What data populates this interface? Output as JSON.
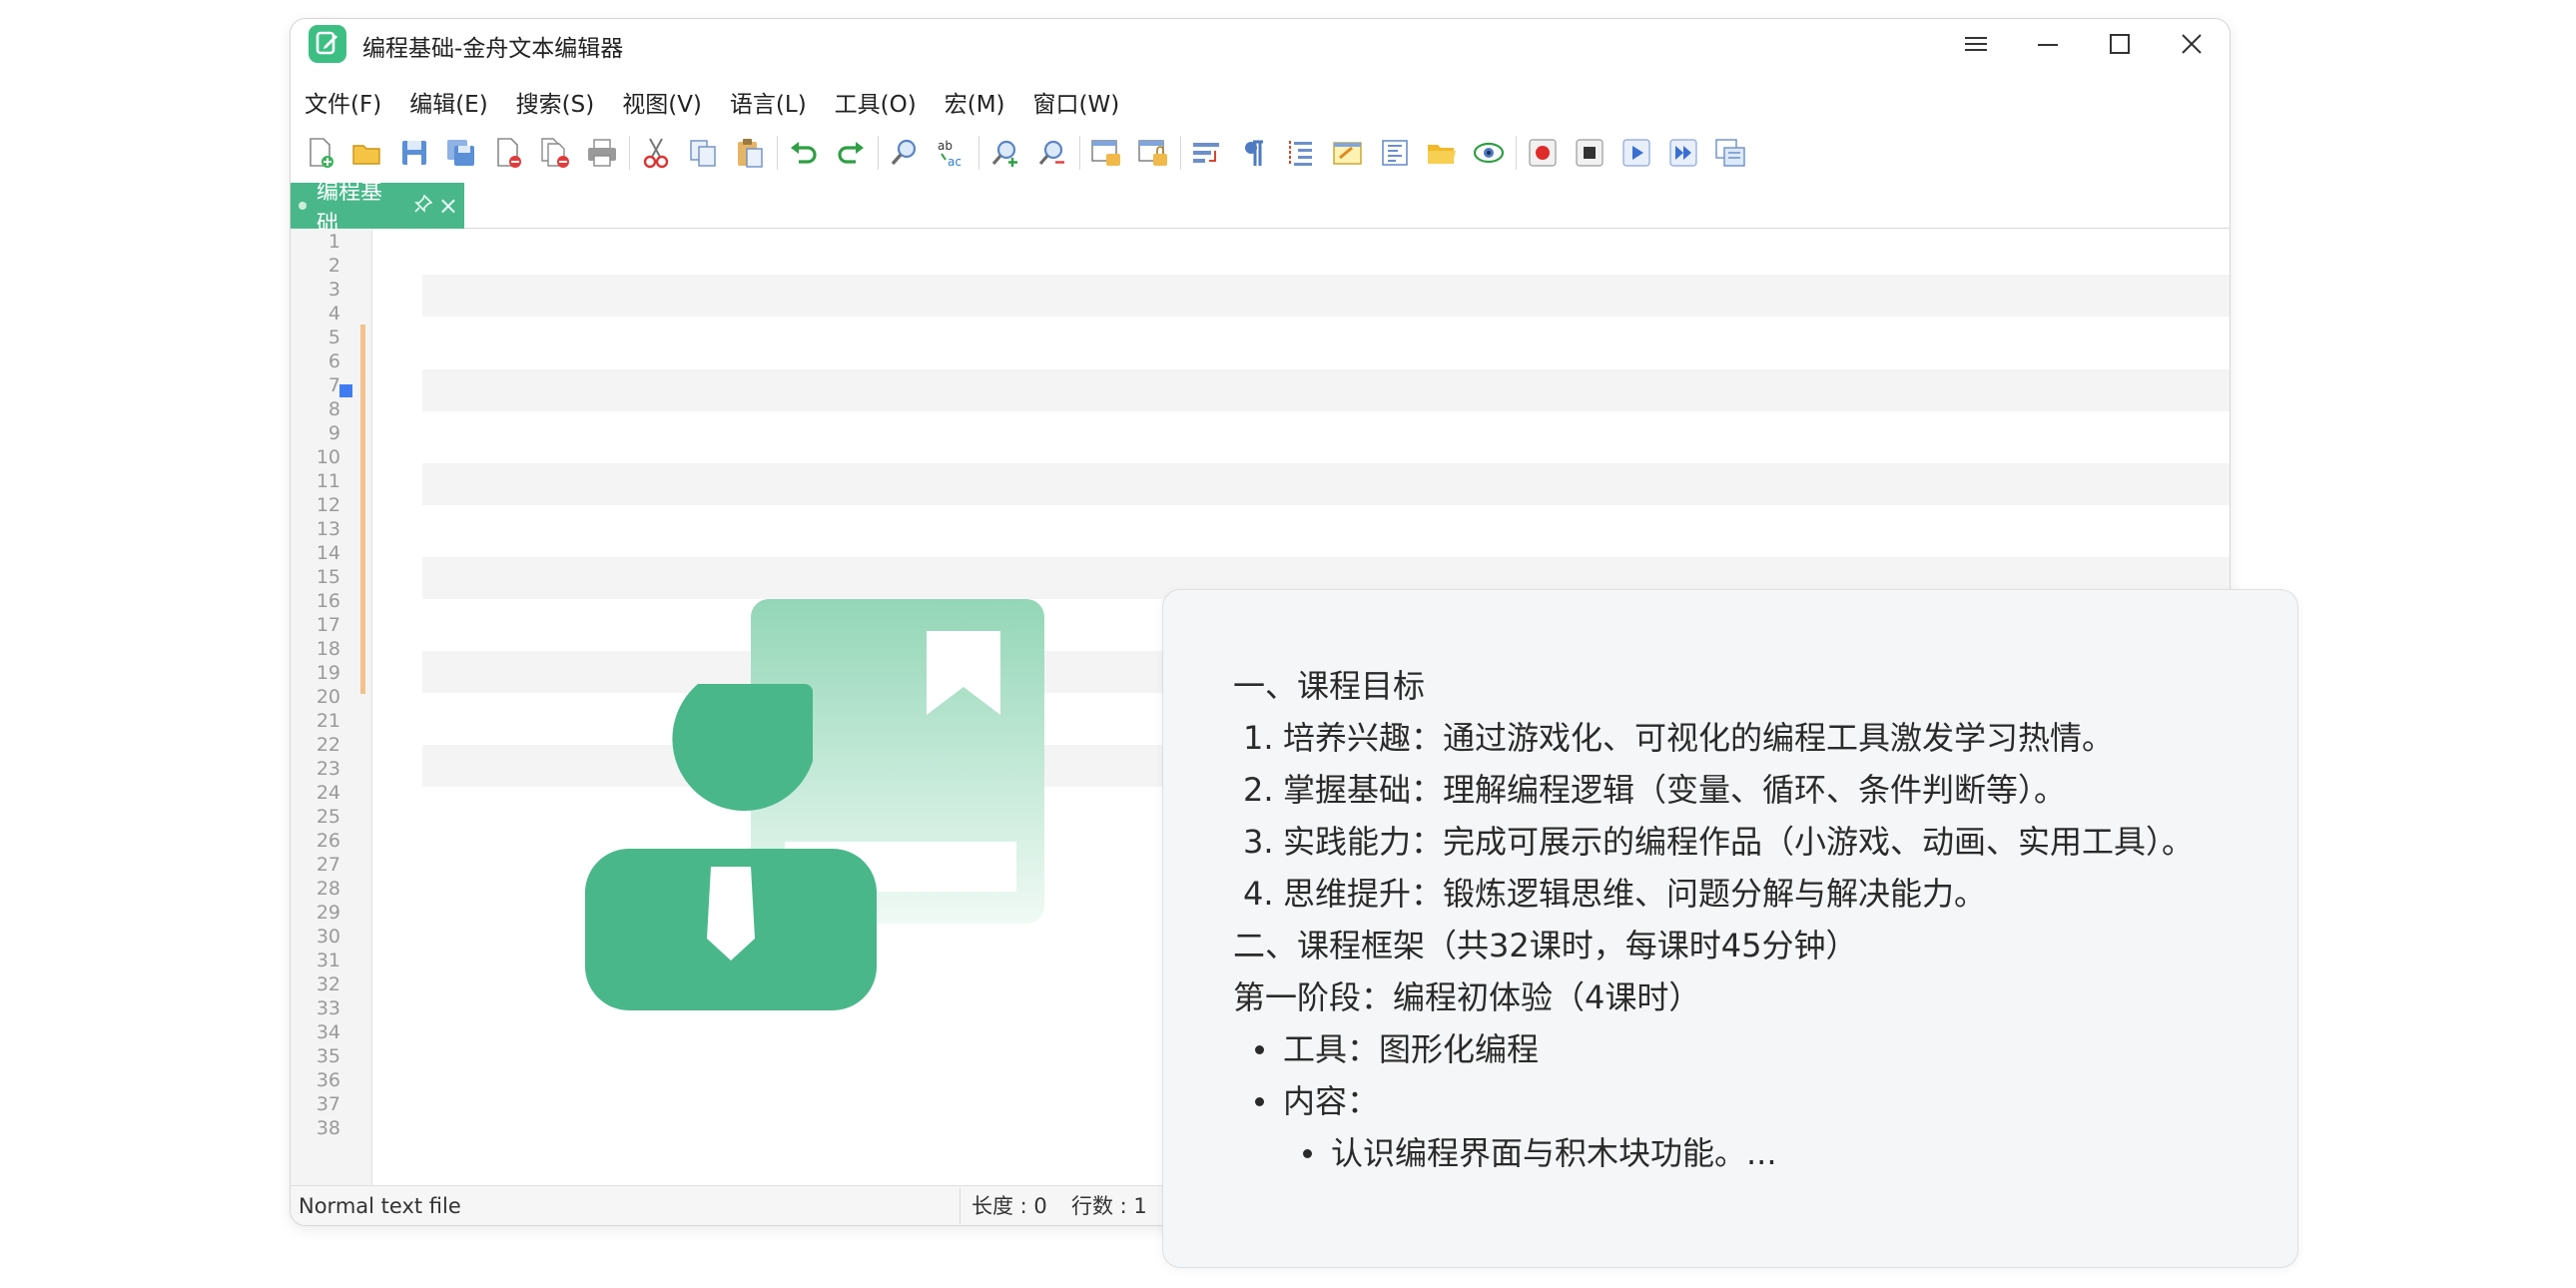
{
  "window": {
    "title": "编程基础-金舟文本编辑器"
  },
  "menu": [
    "文件(F)",
    "编辑(E)",
    "搜索(S)",
    "视图(V)",
    "语言(L)",
    "工具(O)",
    "宏(M)",
    "窗口(W)"
  ],
  "tab": {
    "label": "编程基础",
    "pin_glyph": "⚲",
    "close_glyph": "×"
  },
  "editor": {
    "line_numbers": [
      "1",
      "2",
      "3",
      "4",
      "5",
      "6",
      "7",
      "8",
      "9",
      "10",
      "11",
      "12",
      "13",
      "14",
      "15",
      "16",
      "17",
      "18",
      "19",
      "20",
      "21",
      "22",
      "23",
      "24",
      "25",
      "26",
      "27",
      "28",
      "29",
      "30",
      "31",
      "32",
      "33",
      "34",
      "35",
      "36",
      "37",
      "38"
    ]
  },
  "status": {
    "file_type": "Normal text file",
    "length": "长度 : 0",
    "lines": "行数 : 1"
  },
  "card": {
    "heading1": "一、课程目标",
    "goals": [
      {
        "num": "1.",
        "text": "培养兴趣：通过游戏化、可视化的编程工具激发学习热情。"
      },
      {
        "num": "2.",
        "text": "掌握基础：理解编程逻辑（变量、循环、条件判断等）。"
      },
      {
        "num": "3.",
        "text": "实践能力：完成可展示的编程作品（小游戏、动画、实用工具）。"
      },
      {
        "num": "4.",
        "text": "思维提升：锻炼逻辑思维、问题分解与解决能力。"
      }
    ],
    "heading2": "二、课程框架（共32课时，每课时45分钟）",
    "stage1": "第一阶段：编程初体验（4课时）",
    "bullet_tool": "工具：图形化编程",
    "bullet_content": "内容：",
    "sub_bullet": "认识编程界面与积木块功能。..."
  },
  "colors": {
    "accent_green": "#49b78a",
    "fold_orange": "#f3c28c",
    "bookmark_blue": "#3f7cf2",
    "card_bg": "#f5f6f7"
  }
}
